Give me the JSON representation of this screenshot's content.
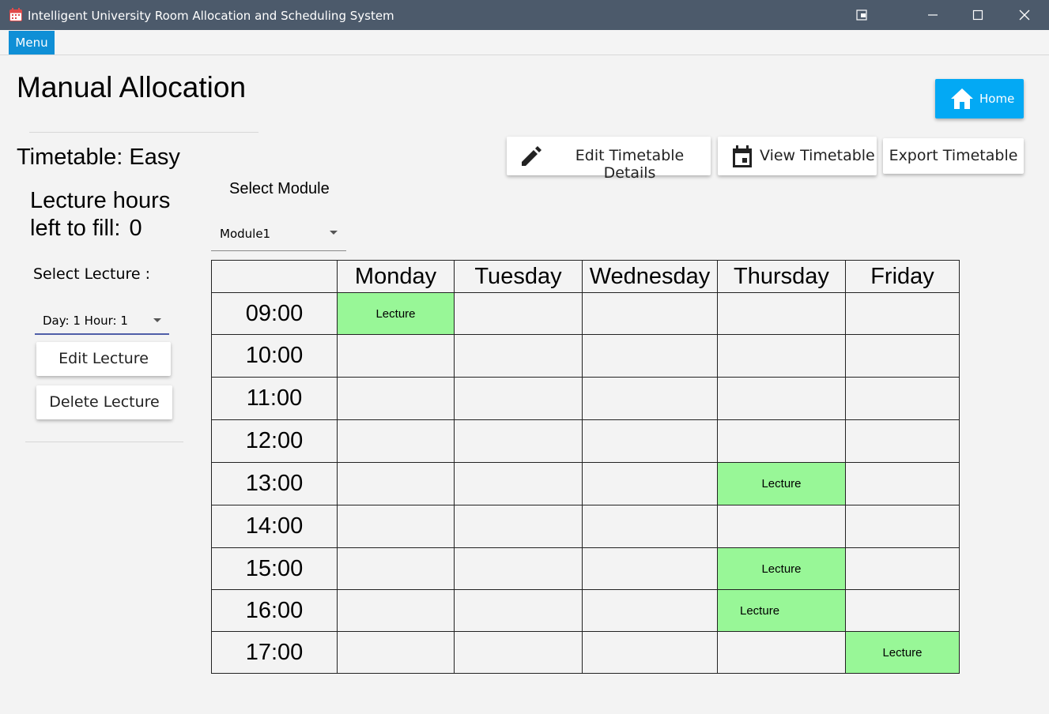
{
  "window": {
    "title": "Intelligent University Room Allocation and Scheduling System"
  },
  "menubar": {
    "menu_label": "Menu"
  },
  "page": {
    "title": "Manual Allocation",
    "timetable_label": "Timetable: Easy",
    "hours_label_line1": "Lecture hours",
    "hours_label_line2": "left to fill:",
    "hours_left": "0",
    "select_lecture_label": "Select Lecture :",
    "lecture_select_value": "Day: 1 Hour: 1",
    "edit_lecture_label": "Edit Lecture",
    "delete_lecture_label": "Delete Lecture",
    "select_module_label": "Select Module",
    "module_select_value": "Module1"
  },
  "toolbar": {
    "home_label": "Home",
    "edit_details_label": "Edit Timetable Details",
    "view_timetable_label": "View Timetable",
    "export_timetable_label": "Export Timetable"
  },
  "timetable": {
    "days": [
      "Monday",
      "Tuesday",
      "Wednesday",
      "Thursday",
      "Friday"
    ],
    "rows": [
      {
        "time": "09:00",
        "cells": [
          "Lecture",
          "",
          "",
          "",
          ""
        ]
      },
      {
        "time": "10:00",
        "cells": [
          "",
          "",
          "",
          "",
          ""
        ]
      },
      {
        "time": "11:00",
        "cells": [
          "",
          "",
          "",
          "",
          ""
        ]
      },
      {
        "time": "12:00",
        "cells": [
          "",
          "",
          "",
          "",
          ""
        ]
      },
      {
        "time": "13:00",
        "cells": [
          "",
          "",
          "",
          "Lecture",
          ""
        ]
      },
      {
        "time": "14:00",
        "cells": [
          "",
          "",
          "",
          "",
          ""
        ]
      },
      {
        "time": "15:00",
        "cells": [
          "",
          "",
          "",
          "Lecture",
          ""
        ]
      },
      {
        "time": "16:00",
        "cells": [
          "",
          "",
          "",
          "Lecture",
          ""
        ]
      },
      {
        "time": "17:00",
        "cells": [
          "",
          "",
          "",
          "",
          "Lecture"
        ]
      }
    ]
  },
  "colors": {
    "titlebar": "#4c5a6b",
    "menu_accent": "#0f8fd6",
    "home_button": "#03a9f4",
    "lecture_cell": "#98f797"
  }
}
